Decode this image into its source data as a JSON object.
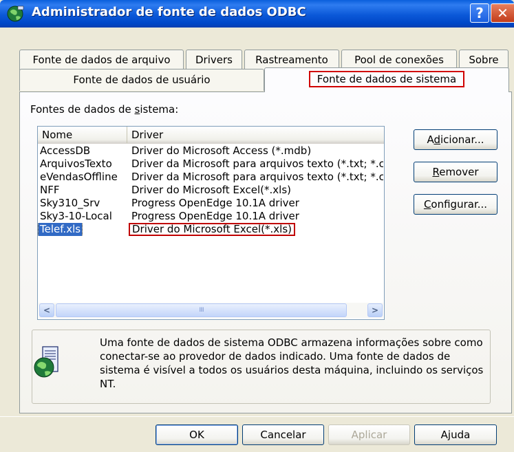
{
  "window": {
    "title": "Administrador de fonte de dados ODBC",
    "help_glyph": "?",
    "close_glyph": "✕"
  },
  "tabs": {
    "row1": [
      {
        "label": "Fonte de dados de arquivo"
      },
      {
        "label": "Drivers"
      },
      {
        "label": "Rastreamento"
      },
      {
        "label": "Pool de conexões"
      },
      {
        "label": "Sobre"
      }
    ],
    "row2": [
      {
        "label": "Fonte de dados de usuário"
      },
      {
        "label": "Fonte de dados de sistema",
        "active": true
      }
    ]
  },
  "group": {
    "label_pre": "Fontes de dados de ",
    "label_mnemonic": "s",
    "label_post": "istema:"
  },
  "list": {
    "columns": [
      "Nome",
      "Driver"
    ],
    "rows": [
      {
        "name": "AccessDB",
        "driver": "Driver do Microsoft Access (*.mdb)"
      },
      {
        "name": "ArquivosTexto",
        "driver": "Driver da Microsoft para arquivos texto (*.txt; *.csv)"
      },
      {
        "name": "eVendasOffline",
        "driver": "Driver da Microsoft para arquivos texto (*.txt; *.csv)"
      },
      {
        "name": "NFF",
        "driver": "Driver do Microsoft Excel(*.xls)"
      },
      {
        "name": "Sky310_Srv",
        "driver": "Progress OpenEdge 10.1A driver"
      },
      {
        "name": "Sky3-10-Local",
        "driver": "Progress OpenEdge 10.1A driver"
      },
      {
        "name": "Telef.xls",
        "driver": "Driver do Microsoft Excel(*.xls)",
        "selected": true
      }
    ],
    "scroll_left_glyph": "<",
    "scroll_right_glyph": ">",
    "scroll_grip": "IIII"
  },
  "side_buttons": {
    "add": {
      "pre": "A",
      "mn": "d",
      "post": "icionar..."
    },
    "remove": {
      "pre": "",
      "mn": "R",
      "post": "emover"
    },
    "configure": {
      "pre": "",
      "mn": "C",
      "post": "onfigurar..."
    }
  },
  "info": {
    "text": "Uma fonte de dados de sistema ODBC armazena informações sobre como conectar-se ao provedor de dados indicado. Uma fonte de dados de sistema é visível a todos os usuários desta máquina, incluindo os serviços NT."
  },
  "bottom_buttons": {
    "ok": "OK",
    "cancel": "Cancelar",
    "apply": "Aplicar",
    "help": "Ajuda"
  },
  "colors": {
    "titlebar": "#0b58d8",
    "selection": "#316ac5",
    "highlight_outline": "#c00000"
  }
}
